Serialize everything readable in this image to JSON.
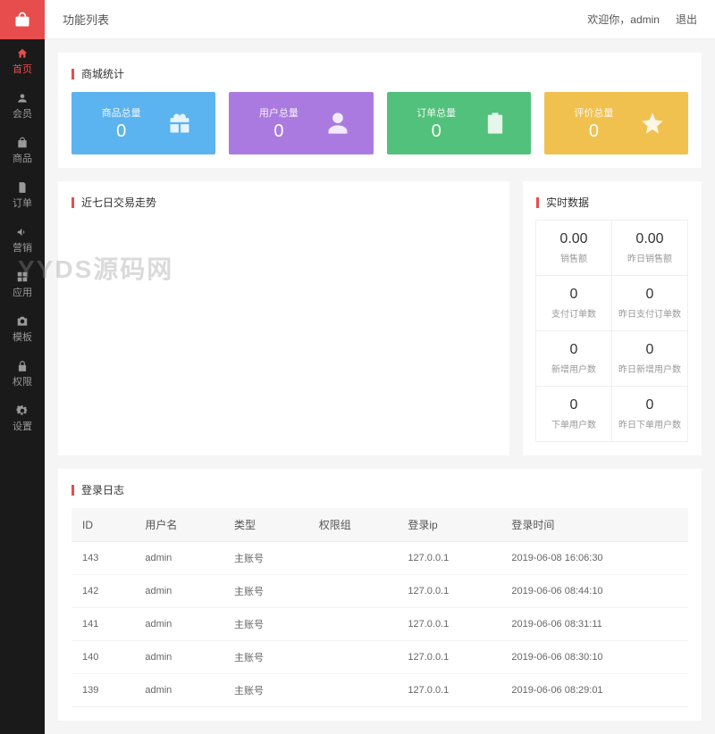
{
  "topbar": {
    "title": "功能列表",
    "welcome_prefix": "欢迎你，",
    "username": "admin",
    "logout": "退出"
  },
  "sidebar": {
    "items": [
      {
        "label": "首页",
        "icon": "home",
        "active": true
      },
      {
        "label": "会员",
        "icon": "user"
      },
      {
        "label": "商品",
        "icon": "bag"
      },
      {
        "label": "订单",
        "icon": "doc"
      },
      {
        "label": "营销",
        "icon": "speaker"
      },
      {
        "label": "应用",
        "icon": "grid"
      },
      {
        "label": "模板",
        "icon": "camera"
      },
      {
        "label": "权限",
        "icon": "lock"
      },
      {
        "label": "设置",
        "icon": "gear"
      }
    ]
  },
  "panels": {
    "stats_title": "商城统计",
    "trend_title": "近七日交易走势",
    "realtime_title": "实时数据",
    "log_title": "登录日志"
  },
  "stats": [
    {
      "label": "商品总量",
      "value": "0",
      "color": "blue",
      "icon": "gift"
    },
    {
      "label": "用户总量",
      "value": "0",
      "color": "purple",
      "icon": "person"
    },
    {
      "label": "订单总量",
      "value": "0",
      "color": "green",
      "icon": "clipboard"
    },
    {
      "label": "评价总量",
      "value": "0",
      "color": "yellow",
      "icon": "star"
    }
  ],
  "realtime": [
    {
      "value": "0.00",
      "label": "销售额"
    },
    {
      "value": "0.00",
      "label": "昨日销售额"
    },
    {
      "value": "0",
      "label": "支付订单数"
    },
    {
      "value": "0",
      "label": "昨日支付订单数"
    },
    {
      "value": "0",
      "label": "新增用户数"
    },
    {
      "value": "0",
      "label": "昨日新增用户数"
    },
    {
      "value": "0",
      "label": "下单用户数"
    },
    {
      "value": "0",
      "label": "昨日下单用户数"
    }
  ],
  "log": {
    "columns": [
      "ID",
      "用户名",
      "类型",
      "权限组",
      "登录ip",
      "登录时间"
    ],
    "rows": [
      [
        "143",
        "admin",
        "主账号",
        "",
        "127.0.0.1",
        "2019-06-08 16:06:30"
      ],
      [
        "142",
        "admin",
        "主账号",
        "",
        "127.0.0.1",
        "2019-06-06 08:44:10"
      ],
      [
        "141",
        "admin",
        "主账号",
        "",
        "127.0.0.1",
        "2019-06-06 08:31:11"
      ],
      [
        "140",
        "admin",
        "主账号",
        "",
        "127.0.0.1",
        "2019-06-06 08:30:10"
      ],
      [
        "139",
        "admin",
        "主账号",
        "",
        "127.0.0.1",
        "2019-06-06 08:29:01"
      ]
    ]
  },
  "watermark": "YYDS源码网"
}
